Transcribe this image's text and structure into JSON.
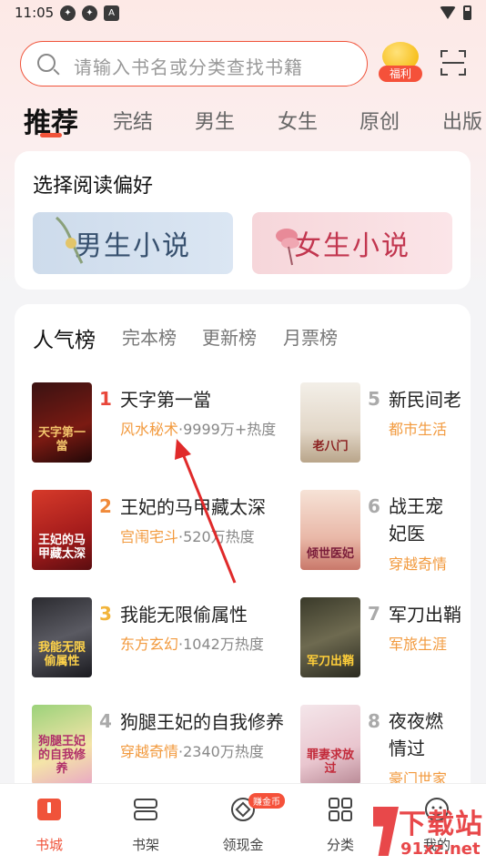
{
  "status": {
    "time": "11:05"
  },
  "search": {
    "placeholder": "请输入书名或分类查找书籍"
  },
  "welfare": {
    "label": "福利"
  },
  "tabs": [
    {
      "label": "推荐",
      "active": true
    },
    {
      "label": "完结"
    },
    {
      "label": "男生"
    },
    {
      "label": "女生"
    },
    {
      "label": "原创"
    },
    {
      "label": "出版"
    }
  ],
  "preference": {
    "title": "选择阅读偏好",
    "male": "男生小说",
    "female": "女生小说"
  },
  "ranking": {
    "tabs": [
      {
        "label": "人气榜",
        "active": true
      },
      {
        "label": "完本榜"
      },
      {
        "label": "更新榜"
      },
      {
        "label": "月票榜"
      }
    ],
    "books": [
      {
        "rank": "1",
        "title": "天字第一當",
        "category": "风水秘术",
        "heat": "·9999万+热度",
        "cover_text": "天字第一當"
      },
      {
        "rank": "2",
        "title": "王妃的马甲藏太深",
        "category": "宫闱宅斗",
        "heat": "·520万热度",
        "cover_text": "王妃的马甲藏太深"
      },
      {
        "rank": "3",
        "title": "我能无限偷属性",
        "category": "东方玄幻",
        "heat": "·1042万热度",
        "cover_text": "我能无限偷属性"
      },
      {
        "rank": "4",
        "title": "狗腿王妃的自我修养",
        "category": "穿越奇情",
        "heat": "·2340万热度",
        "cover_text": "狗腿王妃的自我修养"
      },
      {
        "rank": "5",
        "title": "新民间老",
        "category": "都市生活",
        "heat": "",
        "cover_text": "老八门"
      },
      {
        "rank": "6",
        "title": "战王宠妃医",
        "category": "穿越奇情",
        "heat": "",
        "cover_text": "倾世医妃"
      },
      {
        "rank": "7",
        "title": "军刀出鞘",
        "category": "军旅生涯",
        "heat": "",
        "cover_text": "军刀出鞘"
      },
      {
        "rank": "8",
        "title": "夜夜燃情过",
        "category": "豪门世家",
        "heat": "",
        "cover_text": "罪妻求放过"
      }
    ]
  },
  "nav": [
    {
      "label": "书城",
      "icon": "book-store-icon",
      "active": true
    },
    {
      "label": "书架",
      "icon": "bookshelf-icon"
    },
    {
      "label": "领现金",
      "icon": "cash-coin-icon",
      "badge": "赚金币"
    },
    {
      "label": "分类",
      "icon": "category-grid-icon"
    },
    {
      "label": "我的",
      "icon": "profile-face-icon"
    }
  ],
  "watermark": {
    "big": "下载站",
    "small": "91xz.net"
  },
  "colors": {
    "accent": "#f0533a",
    "category": "#f29a3e"
  }
}
